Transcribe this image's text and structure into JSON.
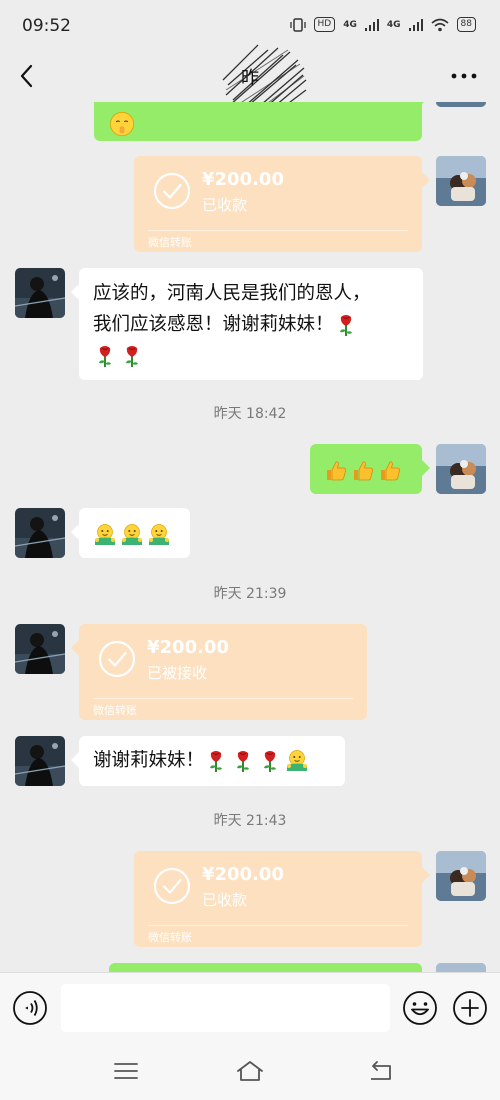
{
  "status_bar": {
    "time": "09:52",
    "hd": "HD",
    "net1": "4G",
    "net2": "4G",
    "battery": "88"
  },
  "header": {
    "title": "昨",
    "back_icon": "chevron-left-icon",
    "more_icon": "more-dots-icon"
  },
  "messages": [
    {
      "id": "m0",
      "type": "text",
      "side": "right",
      "content": "[partial emoji bubble]"
    },
    {
      "id": "m1",
      "type": "transfer",
      "side": "right",
      "amount": "¥200.00",
      "status": "已收款",
      "footer": "微信转账"
    },
    {
      "id": "m2",
      "type": "text",
      "side": "left",
      "line1": "应该的，河南人民是我们的恩人，",
      "line2": "我们应该感恩！谢谢莉妹妹！"
    },
    {
      "id": "ts1",
      "type": "timestamp",
      "text": "昨天 18:42"
    },
    {
      "id": "m3",
      "type": "emoji",
      "side": "right",
      "emojis": [
        "thumbs-up-icon",
        "thumbs-up-icon",
        "thumbs-up-icon"
      ]
    },
    {
      "id": "m4",
      "type": "emoji",
      "side": "left",
      "emojis": [
        "hug-icon",
        "hug-icon",
        "hug-icon"
      ]
    },
    {
      "id": "ts2",
      "type": "timestamp",
      "text": "昨天 21:39"
    },
    {
      "id": "m5",
      "type": "transfer",
      "side": "left",
      "amount": "¥200.00",
      "status": "已被接收",
      "footer": "微信转账"
    },
    {
      "id": "m6",
      "type": "text",
      "side": "left",
      "line1": "谢谢莉妹妹！"
    },
    {
      "id": "ts3",
      "type": "timestamp",
      "text": "昨天 21:43"
    },
    {
      "id": "m7",
      "type": "transfer",
      "side": "right",
      "amount": "¥200.00",
      "status": "已收款",
      "footer": "微信转账"
    }
  ],
  "input_bar": {
    "placeholder": "",
    "voice_icon": "voice-icon",
    "emoji_icon": "smiley-icon",
    "plus_icon": "plus-circle-icon"
  },
  "nav_bar": {
    "menu_icon": "menu-icon",
    "home_icon": "home-icon",
    "back_icon": "back-arrow-icon"
  },
  "colors": {
    "chat_bg": "#ededed",
    "my_bubble": "#95ec69",
    "their_bubble": "#ffffff",
    "transfer": "#fde0bf"
  }
}
